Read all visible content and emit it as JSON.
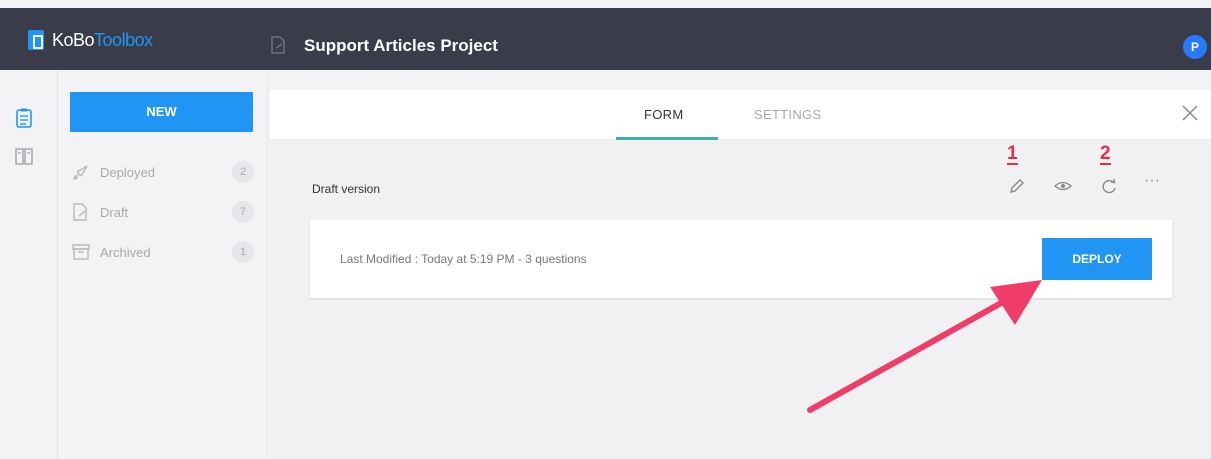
{
  "header": {
    "logo_kobo": "KoBo",
    "logo_toolbox": "Toolbox",
    "project_title": "Support Articles Project",
    "avatar_initial": "P"
  },
  "sidebar": {
    "new_label": "NEW",
    "items": [
      {
        "label": "Deployed",
        "count": "2",
        "icon": "rocket-icon"
      },
      {
        "label": "Draft",
        "count": "7",
        "icon": "draft-icon"
      },
      {
        "label": "Archived",
        "count": "1",
        "icon": "archive-icon"
      }
    ]
  },
  "tabs": [
    {
      "label": "FORM",
      "active": true
    },
    {
      "label": "SETTINGS",
      "active": false
    }
  ],
  "form": {
    "section_title": "Draft version",
    "last_modified": "Last Modified : Today at 5:19 PM - 3 questions",
    "deploy_label": "DEPLOY",
    "more_label": "···"
  },
  "annotations": {
    "one": "1",
    "two": "2"
  },
  "colors": {
    "header_bg": "#3a3c4a",
    "accent_blue": "#2095f3",
    "tab_underline": "#3bb0ac",
    "annotation_red": "#e52c4c"
  }
}
